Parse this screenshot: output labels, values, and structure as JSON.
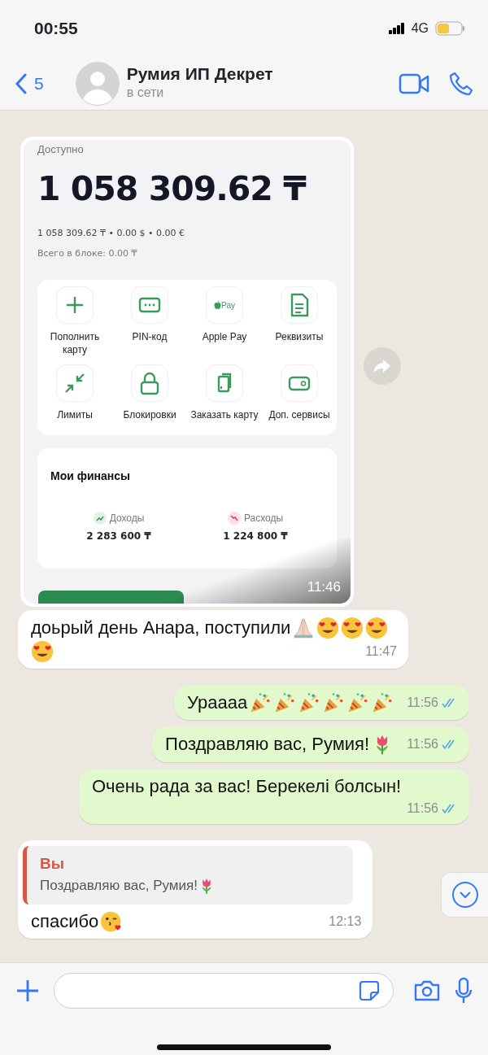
{
  "status_bar": {
    "time": "00:55",
    "network": "4G"
  },
  "header": {
    "back_count": "5",
    "contact_name": "Румия ИП Декрет",
    "status": "в сети"
  },
  "messages": [
    {
      "kind": "image",
      "outgoing": false,
      "time": "11:46",
      "screenshot": {
        "available_label": "Доступно",
        "balance": "1 058 309.62 ₸",
        "balances_line": "1 058 309.62 ₸ • 0.00 $ • 0.00 €",
        "blocked": "Всего в блоке: 0.00 ₸",
        "actions": [
          {
            "kind": "plus",
            "label": "Пополнить карту"
          },
          {
            "kind": "pin",
            "label": "PIN-код"
          },
          {
            "kind": "apple_pay",
            "icon_text": "Pay",
            "label": "Apple Pay"
          },
          {
            "kind": "document",
            "label": "Реквизиты"
          },
          {
            "kind": "arrows",
            "label": "Лимиты"
          },
          {
            "kind": "lock",
            "label": "Блокировки"
          },
          {
            "kind": "cards",
            "label": "Заказать карту"
          },
          {
            "kind": "wallet",
            "label": "Доп. сервисы"
          }
        ],
        "finances": {
          "title": "Мои финансы",
          "items": [
            {
              "kind": "income",
              "label": "Доходы",
              "amount": "2 283 600 ₸"
            },
            {
              "kind": "expense",
              "label": "Расходы",
              "amount": "1 224 800 ₸"
            }
          ]
        }
      }
    },
    {
      "kind": "text",
      "outgoing": false,
      "text": "доьрый день Анара, поступили",
      "emojis": [
        {
          "kind": "pray"
        },
        {
          "kind": "heart_eyes"
        },
        {
          "kind": "heart_eyes"
        },
        {
          "kind": "heart_eyes"
        },
        {
          "kind": "heart_eyes"
        }
      ],
      "time": "11:47"
    },
    {
      "kind": "text",
      "outgoing": true,
      "text": "Ураааа",
      "emojis": [
        {
          "kind": "party"
        },
        {
          "kind": "party"
        },
        {
          "kind": "party"
        },
        {
          "kind": "party"
        },
        {
          "kind": "party"
        },
        {
          "kind": "party"
        }
      ],
      "time": "11:56",
      "read": true
    },
    {
      "kind": "text",
      "outgoing": true,
      "text": "Поздравляю вас, Румия!",
      "emojis": [
        {
          "kind": "tulip"
        }
      ],
      "time": "11:56",
      "read": true
    },
    {
      "kind": "text",
      "outgoing": true,
      "text": "Очень рада за вас! Берекелі болсын!",
      "time": "11:56",
      "read": true
    },
    {
      "kind": "reply",
      "outgoing": false,
      "quote": {
        "author": "Вы",
        "text": "Поздравляю вас, Румия!",
        "emojis": [
          {
            "kind": "tulip"
          }
        ]
      },
      "text": "спасибо",
      "emojis": [
        {
          "kind": "kiss"
        }
      ],
      "time": "12:13"
    }
  ]
}
